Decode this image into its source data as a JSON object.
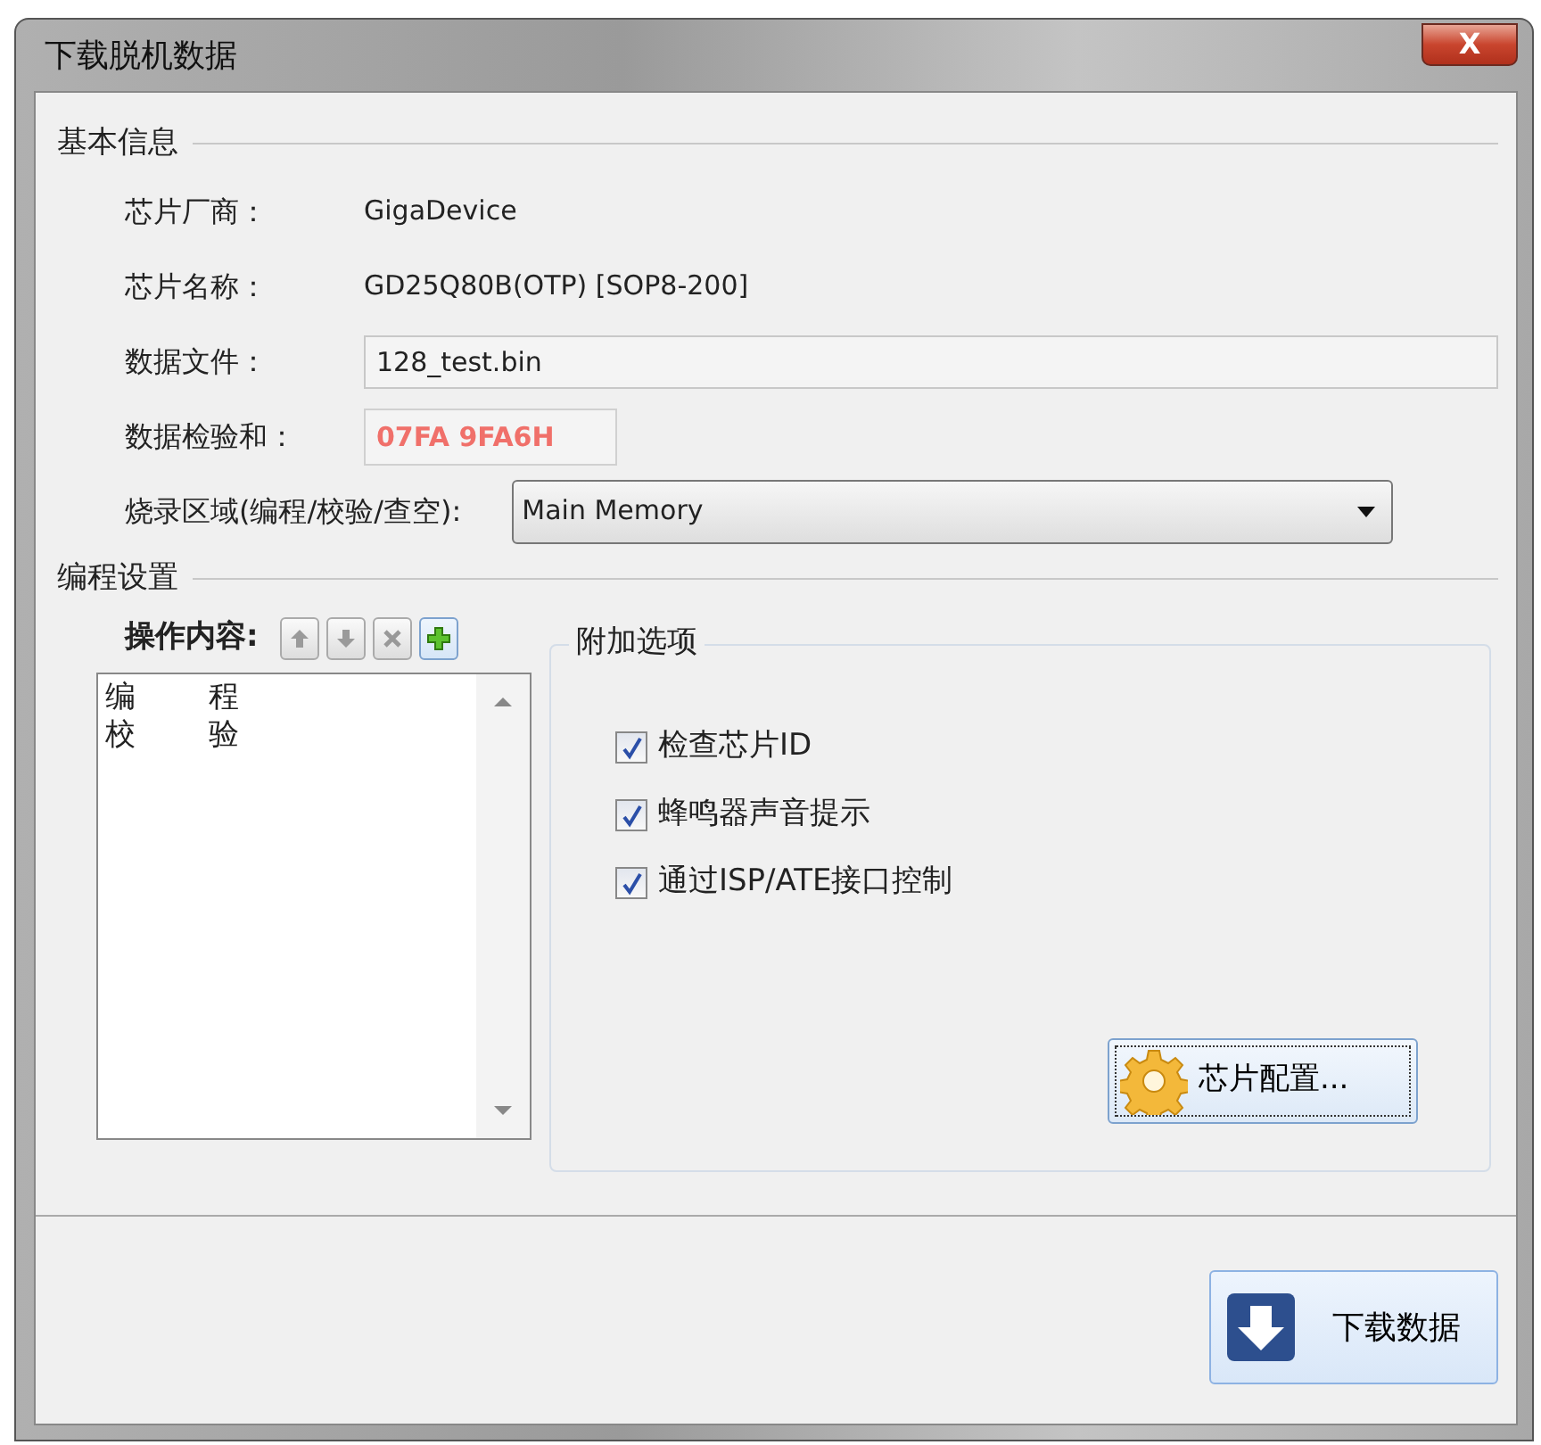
{
  "window": {
    "title": "下载脱机数据",
    "close_label": "X"
  },
  "basic_info": {
    "title": "基本信息",
    "fields": [
      {
        "kind": "text",
        "label": "芯片厂商：",
        "value": "GigaDevice"
      },
      {
        "kind": "text",
        "label": "芯片名称：",
        "value": "GD25Q80B(OTP) [SOP8-200]"
      },
      {
        "kind": "field",
        "label": "数据文件：",
        "value": "128_test.bin"
      },
      {
        "kind": "checksum",
        "label": "数据检验和：",
        "value": "07FA 9FA6H"
      },
      {
        "kind": "dropdown",
        "label": "烧录区域(编程/校验/查空):",
        "value": "Main Memory"
      }
    ]
  },
  "program_settings": {
    "title": "编程设置",
    "operations": {
      "label": "操作内容:",
      "tools": [
        {
          "kind": "up",
          "disabled": true
        },
        {
          "kind": "down",
          "disabled": true
        },
        {
          "kind": "delete",
          "disabled": true
        },
        {
          "kind": "add",
          "disabled": false
        }
      ],
      "items": [
        "编程",
        "校验"
      ]
    },
    "options": {
      "title": "附加选项",
      "checkboxes": [
        {
          "label": "检查芯片ID",
          "checked": true
        },
        {
          "label": "蜂鸣器声音提示",
          "checked": true
        },
        {
          "label": "通过ISP/ATE接口控制",
          "checked": true
        }
      ],
      "config_button": "芯片配置..."
    }
  },
  "download_button": "下载数据"
}
